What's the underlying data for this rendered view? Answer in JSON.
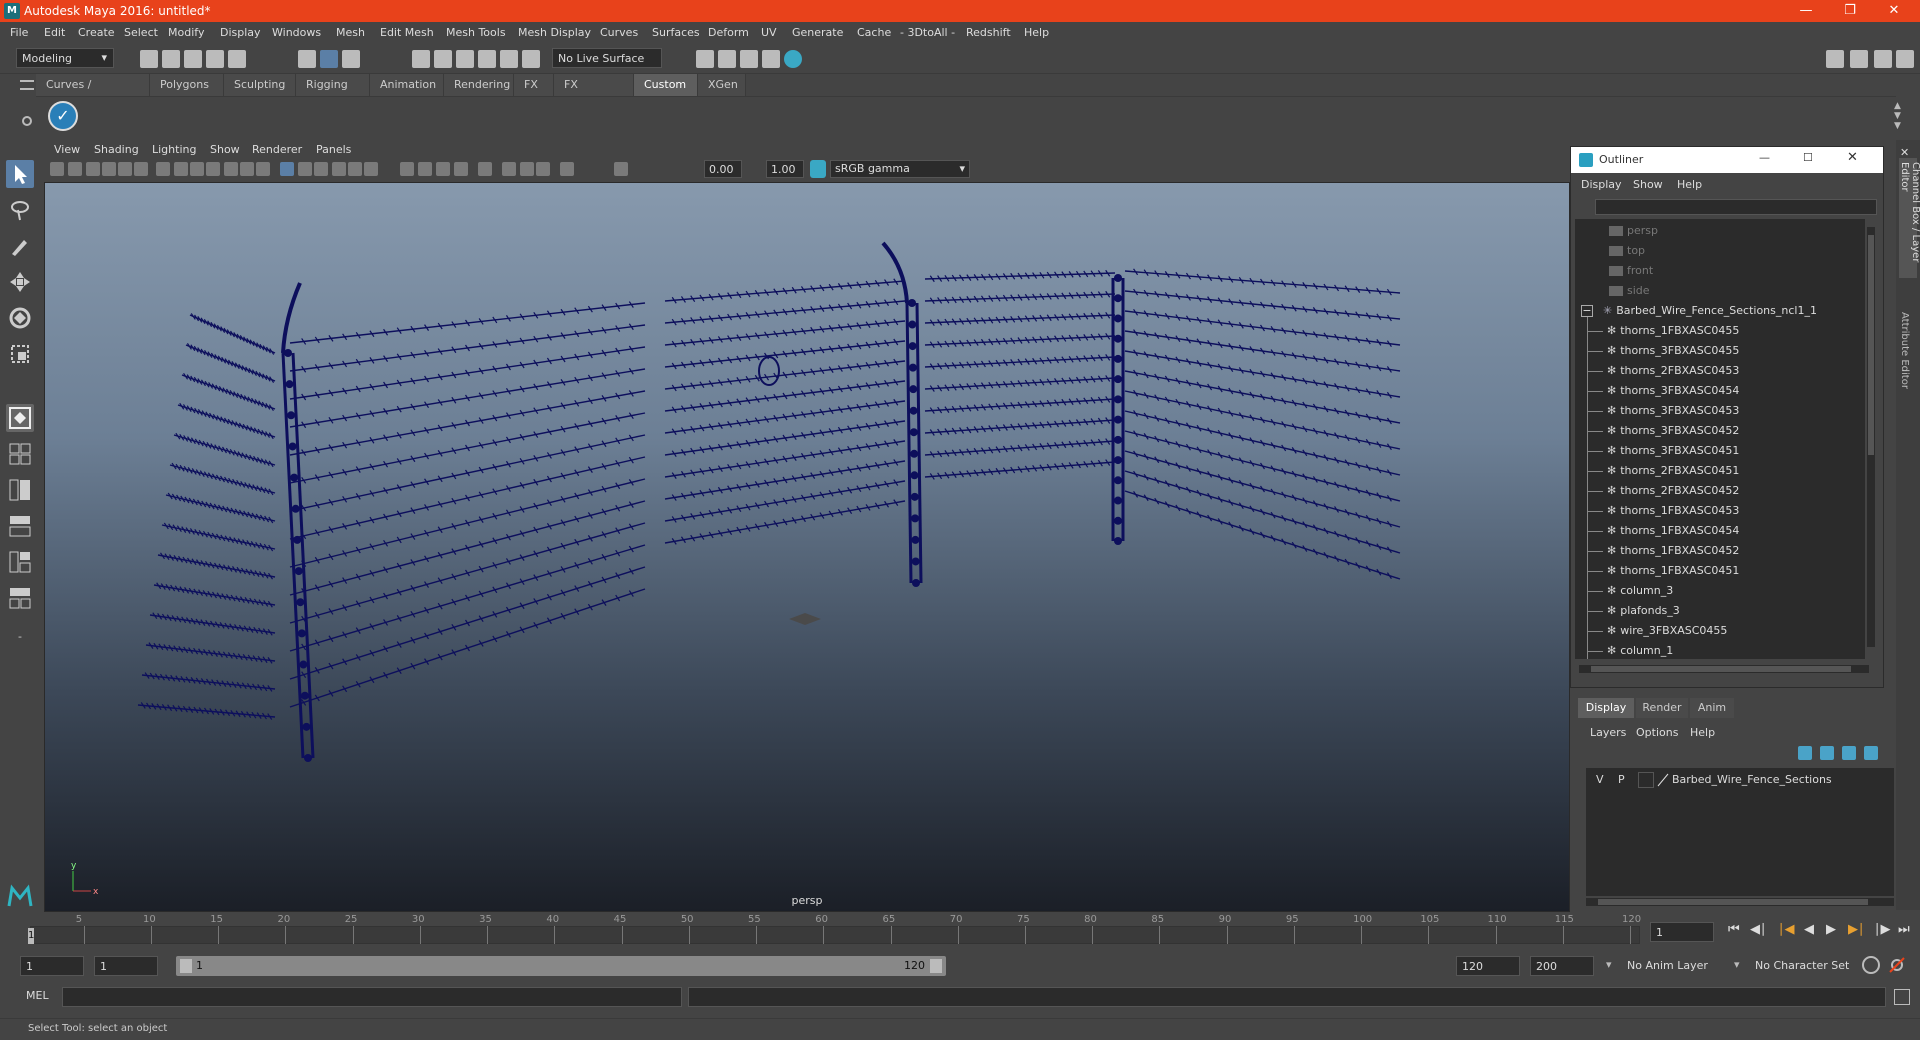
{
  "window": {
    "title": "Autodesk Maya 2016: untitled*",
    "logo": "M"
  },
  "menubar": [
    "File",
    "Edit",
    "Create",
    "Select",
    "Modify",
    "Display",
    "Windows",
    "Mesh",
    "Edit Mesh",
    "Mesh Tools",
    "Mesh Display",
    "Curves",
    "Surfaces",
    "Deform",
    "UV",
    "Generate",
    "Cache",
    "- 3DtoAll -",
    "Redshift",
    "Help"
  ],
  "toolbar": {
    "mode": "Modeling",
    "live_surface": "No Live Surface"
  },
  "shelf_tabs": [
    "Curves / Surfaces",
    "Polygons",
    "Sculpting",
    "Rigging",
    "Animation",
    "Rendering",
    "FX",
    "FX Caching",
    "Custom",
    "XGen"
  ],
  "active_shelf_tab": "Custom",
  "viewport": {
    "menu": [
      "View",
      "Shading",
      "Lighting",
      "Show",
      "Renderer",
      "Panels"
    ],
    "exposure": "0.00",
    "gamma": "1.00",
    "color_space": "sRGB gamma",
    "camera_label": "persp",
    "axis_y": "y",
    "axis_x": "x"
  },
  "outliner": {
    "title": "Outliner",
    "menu": [
      "Display",
      "Show",
      "Help"
    ],
    "cameras": [
      "persp",
      "top",
      "front",
      "side"
    ],
    "group": "Barbed_Wire_Fence_Sections_ncl1_1",
    "children": [
      "thorns_1FBXASC0455",
      "thorns_3FBXASC0455",
      "thorns_2FBXASC0453",
      "thorns_3FBXASC0454",
      "thorns_3FBXASC0453",
      "thorns_3FBXASC0452",
      "thorns_3FBXASC0451",
      "thorns_2FBXASC0451",
      "thorns_2FBXASC0452",
      "thorns_1FBXASC0453",
      "thorns_1FBXASC0454",
      "thorns_1FBXASC0452",
      "thorns_1FBXASC0451",
      "column_3",
      "plafonds_3",
      "wire_3FBXASC0455",
      "column_1"
    ]
  },
  "layer_editor": {
    "tabs": [
      "Display",
      "Render",
      "Anim"
    ],
    "active_tab": "Display",
    "menu": [
      "Layers",
      "Options",
      "Help"
    ],
    "layer": {
      "v": "V",
      "p": "P",
      "name": "Barbed_Wire_Fence_Sections"
    }
  },
  "side_tabs": [
    "Channel Box / Layer Editor",
    "Attribute Editor"
  ],
  "timeline": {
    "ticks": [
      "5",
      "10",
      "15",
      "20",
      "25",
      "30",
      "35",
      "40",
      "45",
      "50",
      "55",
      "60",
      "65",
      "70",
      "75",
      "80",
      "85",
      "90",
      "95",
      "100",
      "105",
      "110",
      "115",
      "120"
    ],
    "start_marker": "1",
    "current_frame": "1"
  },
  "range": {
    "start": "1",
    "anim_start": "1",
    "range_start": "1",
    "range_end": "120",
    "anim_end_a": "120",
    "anim_end_b": "200",
    "anim_layer": "No Anim Layer",
    "character_set": "No Character Set"
  },
  "mel": {
    "label": "MEL"
  },
  "status": {
    "text": "Select Tool: select an object"
  }
}
